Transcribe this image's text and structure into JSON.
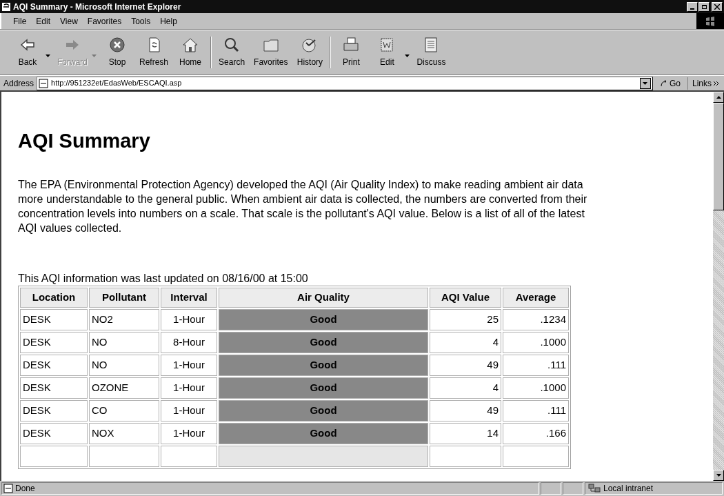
{
  "window": {
    "title": "AQI Summary - Microsoft Internet Explorer"
  },
  "menu": [
    "File",
    "Edit",
    "View",
    "Favorites",
    "Tools",
    "Help"
  ],
  "toolbar": [
    {
      "label": "Back",
      "kind": "back",
      "disabled": false,
      "dropdown": true
    },
    {
      "label": "Forward",
      "kind": "forward",
      "disabled": true,
      "dropdown": true
    },
    {
      "label": "Stop",
      "kind": "stop",
      "disabled": false,
      "dropdown": false
    },
    {
      "label": "Refresh",
      "kind": "refresh",
      "disabled": false,
      "dropdown": false
    },
    {
      "label": "Home",
      "kind": "home",
      "disabled": false,
      "dropdown": false
    },
    {
      "kind": "separator"
    },
    {
      "label": "Search",
      "kind": "search",
      "disabled": false,
      "dropdown": false
    },
    {
      "label": "Favorites",
      "kind": "favorites",
      "disabled": false,
      "dropdown": false
    },
    {
      "label": "History",
      "kind": "history",
      "disabled": false,
      "dropdown": false
    },
    {
      "kind": "separator"
    },
    {
      "label": "Print",
      "kind": "print",
      "disabled": false,
      "dropdown": false
    },
    {
      "label": "Edit",
      "kind": "edit",
      "disabled": false,
      "dropdown": true
    },
    {
      "label": "Discuss",
      "kind": "discuss",
      "disabled": false,
      "dropdown": false
    }
  ],
  "address": {
    "label": "Address",
    "value": "http://951232et/EdasWeb/ESCAQI.asp",
    "go": "Go",
    "links": "Links"
  },
  "page": {
    "heading": "AQI Summary",
    "intro": "The EPA (Environmental Protection Agency) developed the AQI (Air Quality Index) to make reading ambient air data more understandable to the general public. When ambient air data is collected, the numbers are converted from their concentration levels into numbers on a scale. That scale is the pollutant's AQI value. Below is a list of all of the latest AQI values collected.",
    "updated": "This AQI information was last updated on 08/16/00 at 15:00",
    "table": {
      "columns": [
        "Location",
        "Pollutant",
        "Interval",
        "Air Quality",
        "AQI Value",
        "Average"
      ],
      "rows": [
        {
          "cells": [
            "DESK",
            "NO2",
            "1-Hour",
            "Good",
            "25",
            ".1234"
          ],
          "color": "#888888"
        },
        {
          "cells": [
            "DESK",
            "NO",
            "8-Hour",
            "Good",
            "4",
            ".1000"
          ],
          "color": "#888888"
        },
        {
          "cells": [
            "DESK",
            "NO",
            "1-Hour",
            "Good",
            "49",
            ".111"
          ],
          "color": "#888888"
        },
        {
          "cells": [
            "DESK",
            "OZONE",
            "1-Hour",
            "Good",
            "4",
            ".1000"
          ],
          "color": "#888888"
        },
        {
          "cells": [
            "DESK",
            "CO",
            "1-Hour",
            "Good",
            "49",
            ".111"
          ],
          "color": "#888888"
        },
        {
          "cells": [
            "DESK",
            "NOX",
            "1-Hour",
            "Good",
            "14",
            ".166"
          ],
          "color": "#888888"
        },
        {
          "cells": [],
          "color": "#e6e6e6"
        }
      ]
    }
  },
  "status_bar": {
    "text": "Done",
    "zone": "Local intranet"
  }
}
